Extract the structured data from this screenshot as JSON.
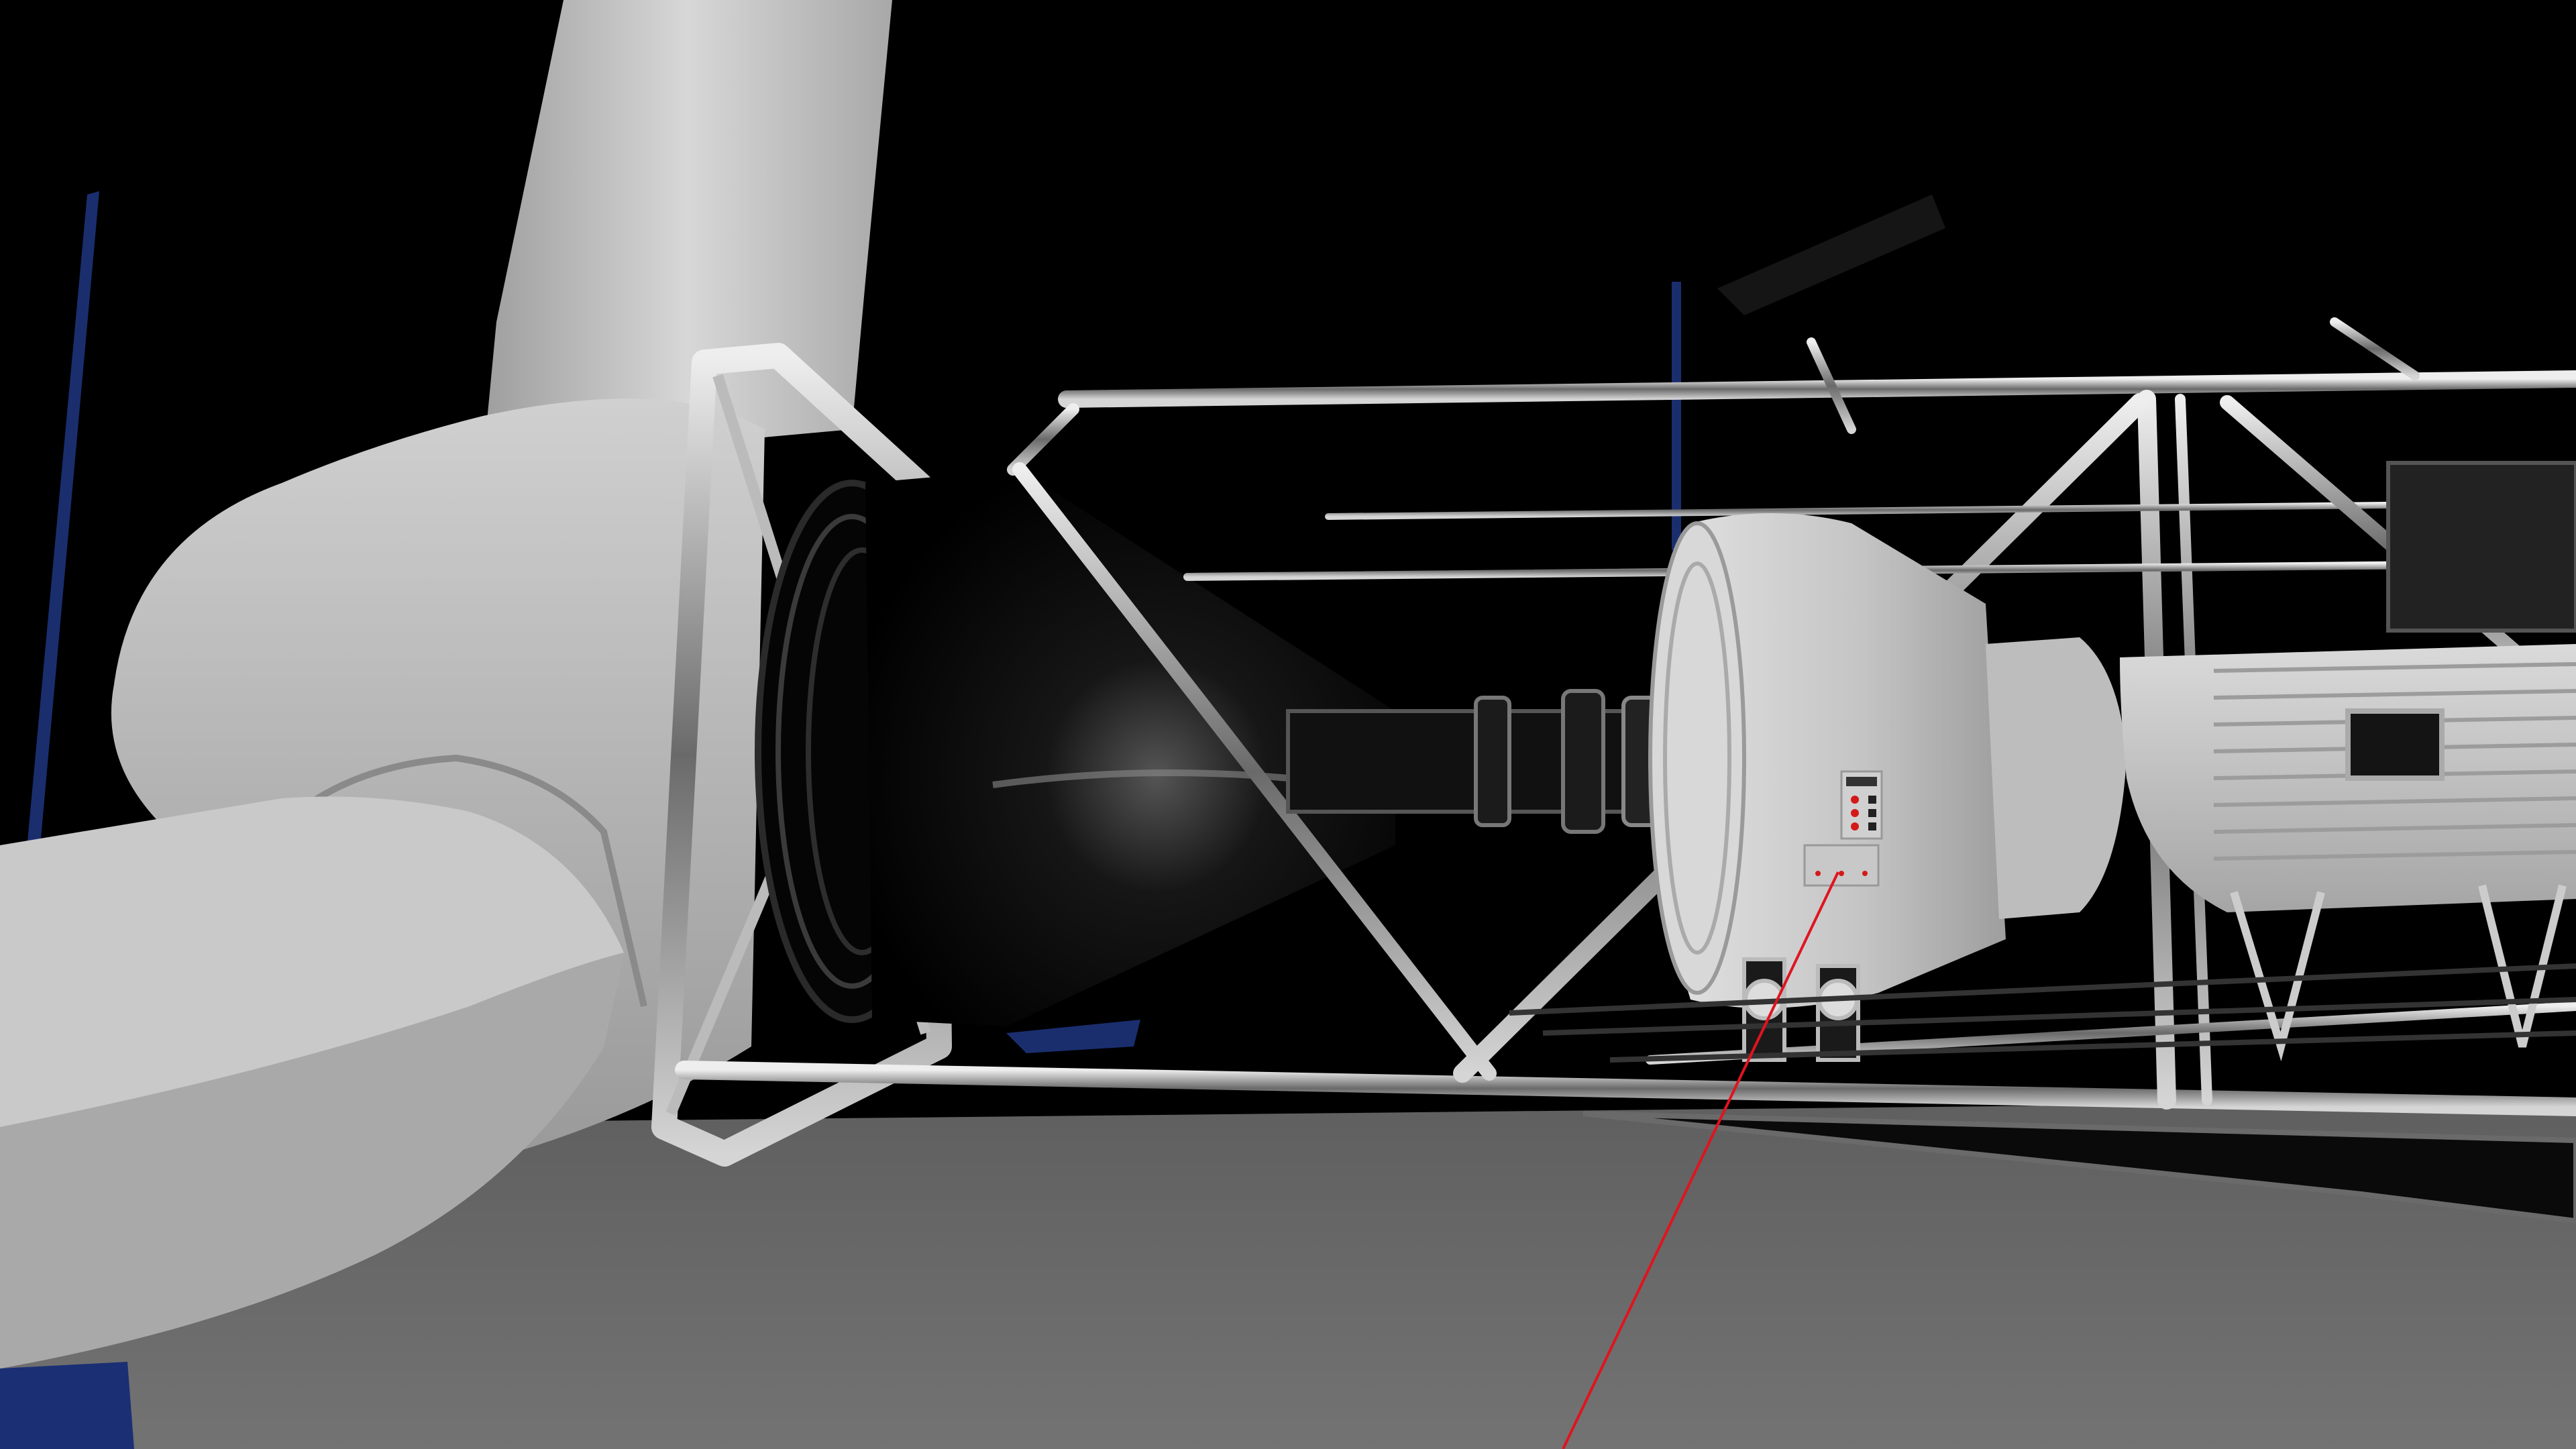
{
  "app": {
    "view_type": "vr-3d-scene",
    "scene_subject": "wind-turbine-nacelle"
  },
  "colors": {
    "background": "#000000",
    "floor": "#6e6e6e",
    "blade": "#bdbdbd",
    "frame_metal": "#c8c8c8",
    "gearbox": "#cfcfcf",
    "hub_cone": "#0b0b0b",
    "laser_pointer": "#e0141e",
    "blue_post": "#1a2e6e",
    "indicator_red": "#d41919"
  },
  "icons": {
    "laser_pointer": "laser-pointer-icon",
    "control_panel": "control-panel-icon"
  }
}
